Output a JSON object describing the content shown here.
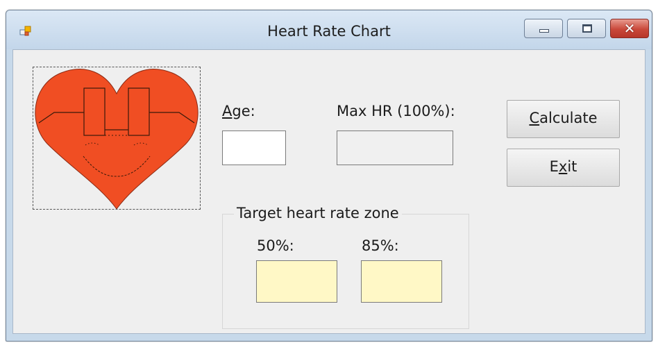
{
  "window": {
    "title": "Heart Rate Chart",
    "controls": {
      "minimize": "–",
      "maximize": "□",
      "close": "✕"
    }
  },
  "form": {
    "picture_icon": "heart-face-image",
    "age": {
      "prefix": "A",
      "rest": "ge:",
      "value": ""
    },
    "max_hr": {
      "label": "Max HR (100%):",
      "value": ""
    },
    "calculate_button": {
      "prefix": "C",
      "rest": "alculate"
    },
    "exit_button": {
      "prefix": "E",
      "mnemonic": "x",
      "rest": "it"
    },
    "target_zone": {
      "title": "Target heart rate zone",
      "low": {
        "label": "50%:",
        "value": ""
      },
      "high": {
        "label": "85%:",
        "value": ""
      }
    }
  },
  "colors": {
    "heart": "#f04e23",
    "titlebar": "#c7d9ea",
    "client": "#efefef",
    "zone_box": "#fff8c6",
    "close_button": "#c9483a"
  }
}
